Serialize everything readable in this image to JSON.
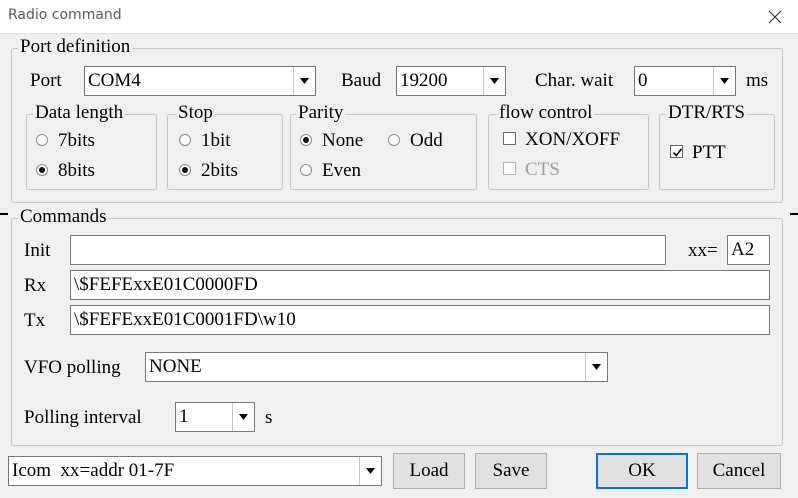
{
  "window": {
    "title": "Radio command"
  },
  "port": {
    "legend": "Port definition",
    "port_label": "Port",
    "port_value": "COM4",
    "baud_label": "Baud",
    "baud_value": "19200",
    "charwait_label": "Char. wait",
    "charwait_value": "0",
    "charwait_unit": "ms"
  },
  "data_length": {
    "legend": "Data length",
    "options": [
      "7bits",
      "8bits"
    ],
    "selected": "8bits"
  },
  "stop": {
    "legend": "Stop",
    "options": [
      "1bit",
      "2bits"
    ],
    "selected": "2bits"
  },
  "parity": {
    "legend": "Parity",
    "options": [
      "None",
      "Odd",
      "Even"
    ],
    "selected": "None"
  },
  "flow_control": {
    "legend": "flow control",
    "xon_label": "XON/XOFF",
    "xon_checked": false,
    "cts_label": "CTS",
    "cts_checked": false,
    "cts_enabled": false
  },
  "dtr_rts": {
    "legend": "DTR/RTS",
    "ptt_label": "PTT",
    "ptt_checked": true
  },
  "commands": {
    "legend": "Commands",
    "init_label": "Init",
    "init_value": "",
    "xx_label": "xx=",
    "xx_value": "A2",
    "rx_label": "Rx",
    "rx_value": "\\$FEFExxE01C0000FD",
    "tx_label": "Tx",
    "tx_value": "\\$FEFExxE01C0001FD\\w10",
    "vfo_label": "VFO polling",
    "vfo_value": "NONE",
    "interval_label": "Polling interval",
    "interval_value": "1",
    "interval_unit": "s"
  },
  "footer": {
    "preset_value": "Icom  xx=addr 01-7F",
    "load_label": "Load",
    "save_label": "Save",
    "ok_label": "OK",
    "cancel_label": "Cancel"
  },
  "colors": {
    "accent": "#0078d7",
    "border": "#c8c8c8",
    "background": "#f0f0f0"
  }
}
